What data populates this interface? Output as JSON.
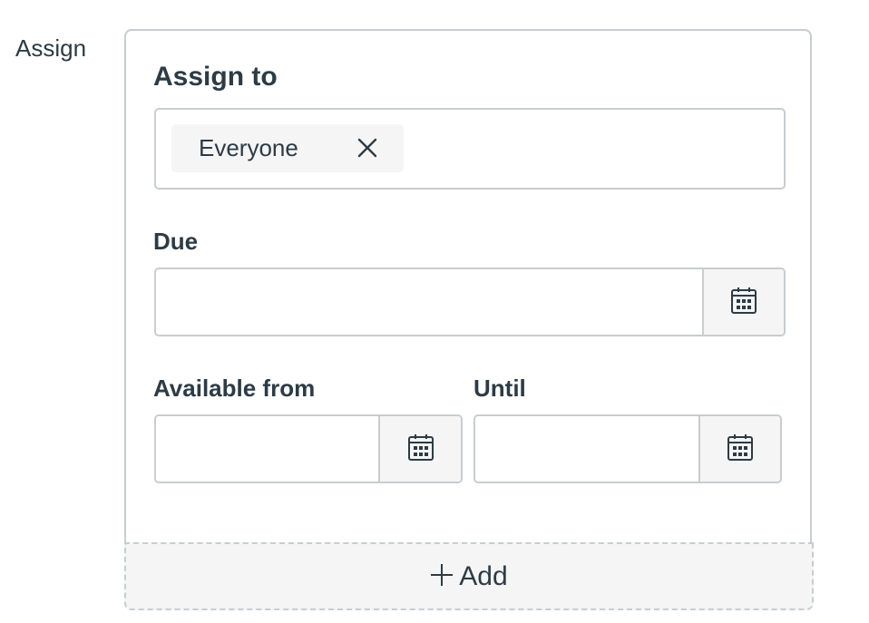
{
  "section": {
    "label": "Assign"
  },
  "assign_card": {
    "assign_to_label": "Assign to",
    "assignees": [
      {
        "label": "Everyone",
        "remove_icon": "close-icon"
      }
    ],
    "due": {
      "label": "Due",
      "value": "",
      "icon": "calendar-icon"
    },
    "available_from": {
      "label": "Available from",
      "value": "",
      "icon": "calendar-icon"
    },
    "until": {
      "label": "Until",
      "value": "",
      "icon": "calendar-icon"
    }
  },
  "add_button": {
    "icon": "plus-icon",
    "label": "Add"
  },
  "colors": {
    "text": "#2d3b45",
    "border": "#c7cdd1",
    "button_bg": "#f5f5f5"
  }
}
